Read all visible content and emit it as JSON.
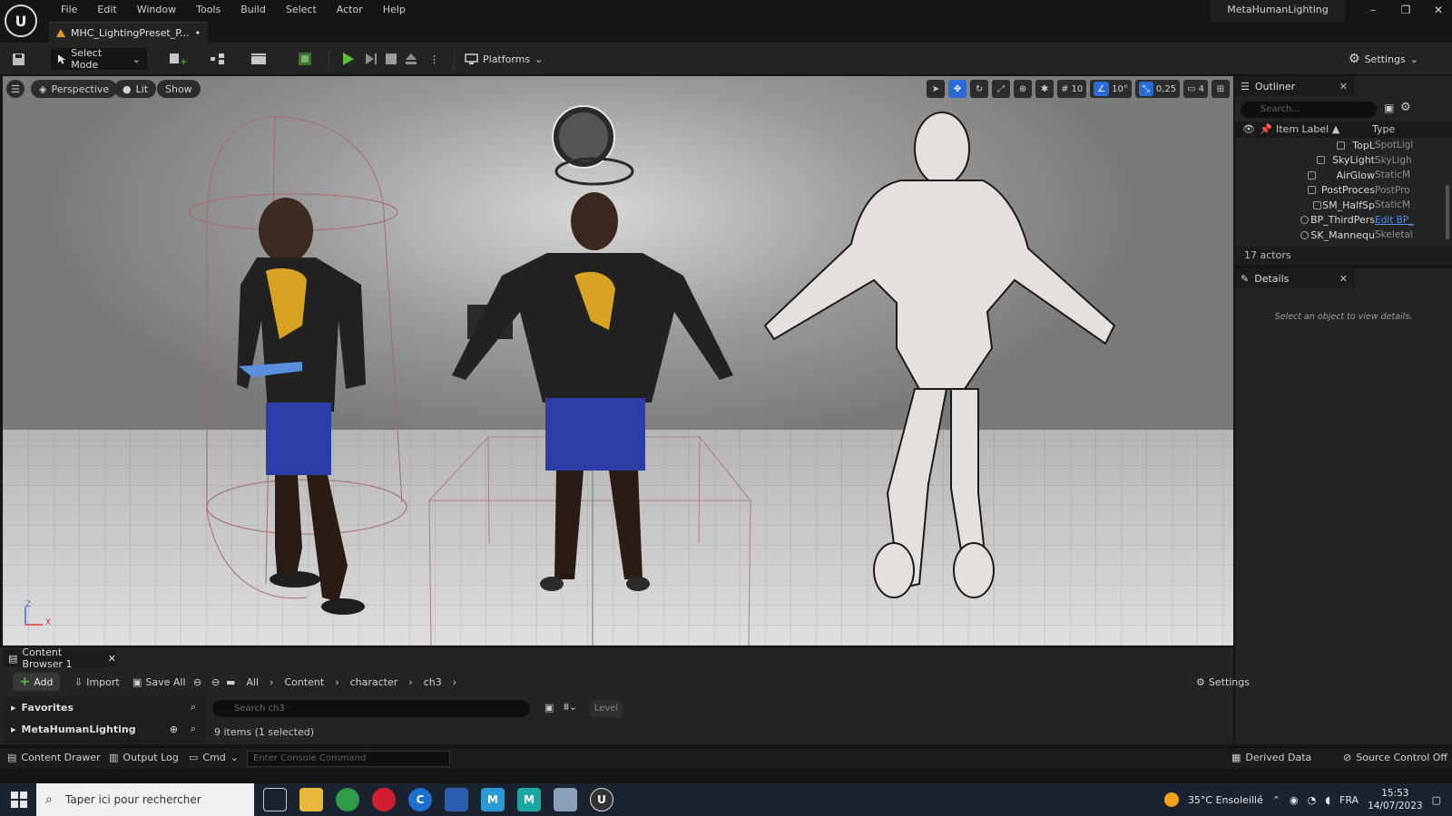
{
  "menu": [
    "File",
    "Edit",
    "Window",
    "Tools",
    "Build",
    "Select",
    "Actor",
    "Help"
  ],
  "document_tab": "MHC_LightingPreset_P...",
  "document_tab_dirty": "•",
  "project_name": "MetaHumanLighting",
  "window_controls": {
    "minimize": "–",
    "restore": "❐",
    "close": "✕"
  },
  "toolbar": {
    "select_mode": "Select Mode",
    "platforms": "Platforms",
    "settings": "Settings"
  },
  "viewport": {
    "perspective": "Perspective",
    "lit": "Lit",
    "show": "Show",
    "grid_size": "10",
    "rotation_snap": "10°",
    "scale_snap": "0,25",
    "camera_speed": "4",
    "axis_z": "Z",
    "axis_x": "X"
  },
  "outliner": {
    "title": "Outliner",
    "search_placeholder": "Search...",
    "col_label": "Item Label ▲",
    "col_type": "Type",
    "rows": [
      {
        "label": "TopL",
        "type": "SpotLigl",
        "link": false
      },
      {
        "label": "SkyLight",
        "type": "SkyLigh",
        "link": false
      },
      {
        "label": "AirGlow",
        "type": "StaticM",
        "link": false
      },
      {
        "label": "PostProces",
        "type": "PostPro",
        "link": false
      },
      {
        "label": "SM_HalfSp",
        "type": "StaticM",
        "link": false
      },
      {
        "label": "BP_ThirdPers",
        "type": "Edit BP_",
        "link": true
      },
      {
        "label": "SK_Mannequ",
        "type": "Skeletal",
        "link": false
      }
    ],
    "actor_count": "17 actors"
  },
  "details": {
    "title": "Details",
    "empty_message": "Select an object to view details."
  },
  "content_browser": {
    "tab": "Content Browser 1",
    "add": "Add",
    "import": "Import",
    "save_all": "Save All",
    "breadcrumb": [
      "All",
      "Content",
      "character",
      "ch3"
    ],
    "settings": "Settings",
    "favorites": "Favorites",
    "collections": "MetaHumanLighting",
    "search_placeholder": "Search ch3",
    "level_chip": "Level",
    "item_count": "9 items (1 selected)"
  },
  "statusbar": {
    "content_drawer": "Content Drawer",
    "output_log": "Output Log",
    "cmd": "Cmd",
    "console_placeholder": "Enter Console Command",
    "derived_data": "Derived Data",
    "source_control": "Source Control Off"
  },
  "taskbar": {
    "search_placeholder": "Taper ici pour rechercher",
    "weather": "35°C  Ensoleillé",
    "language": "FRA",
    "time": "15:53",
    "date": "14/07/2023"
  },
  "colors": {
    "accent_blue": "#2a6bd4",
    "play_green": "#5cbf3a",
    "link_blue": "#4f8fe8"
  }
}
